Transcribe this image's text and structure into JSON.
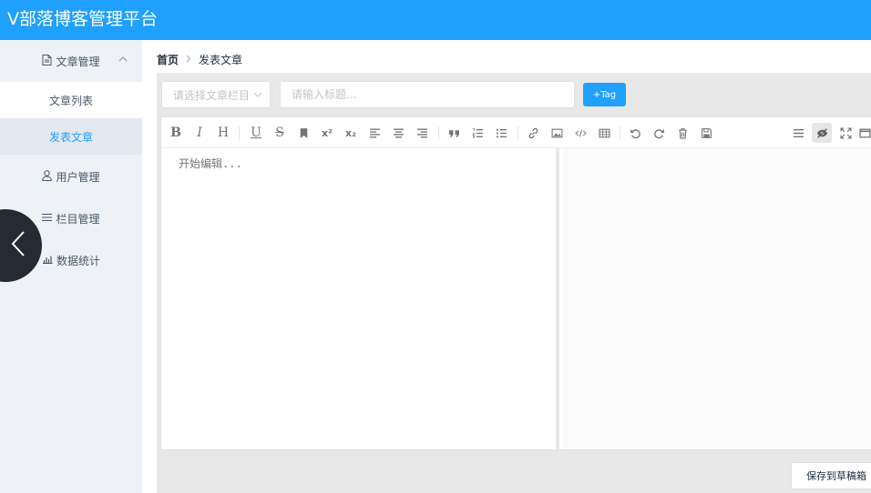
{
  "app": {
    "title": "V部落博客管理平台"
  },
  "sidebar": {
    "groups": [
      {
        "label": "文章管理",
        "icon": "document-icon",
        "expanded": true,
        "items": [
          {
            "label": "文章列表"
          },
          {
            "label": "发表文章",
            "active": true
          }
        ]
      },
      {
        "label": "用户管理",
        "icon": "user-icon"
      },
      {
        "label": "栏目管理",
        "icon": "menu-icon"
      },
      {
        "label": "数据统计",
        "icon": "bar-chart-icon"
      }
    ]
  },
  "breadcrumb": {
    "home": "首页",
    "current": "发表文章"
  },
  "form": {
    "category_placeholder": "请选择文章栏目",
    "title_placeholder": "请输入标题...",
    "tag_button": "+Tag"
  },
  "editor": {
    "placeholder": "开始编辑...",
    "toolbar": {
      "bold": "B",
      "italic": "I",
      "header": "H",
      "underline": "U",
      "strikethrough": "S",
      "superscript": "x²",
      "subscript": "x₂"
    }
  },
  "actions": {
    "save_draft": "保存到草稿箱"
  },
  "colors": {
    "primary": "#20a0ff",
    "sidebar_bg": "#eef1f6",
    "collapse_button": "#252a33"
  }
}
